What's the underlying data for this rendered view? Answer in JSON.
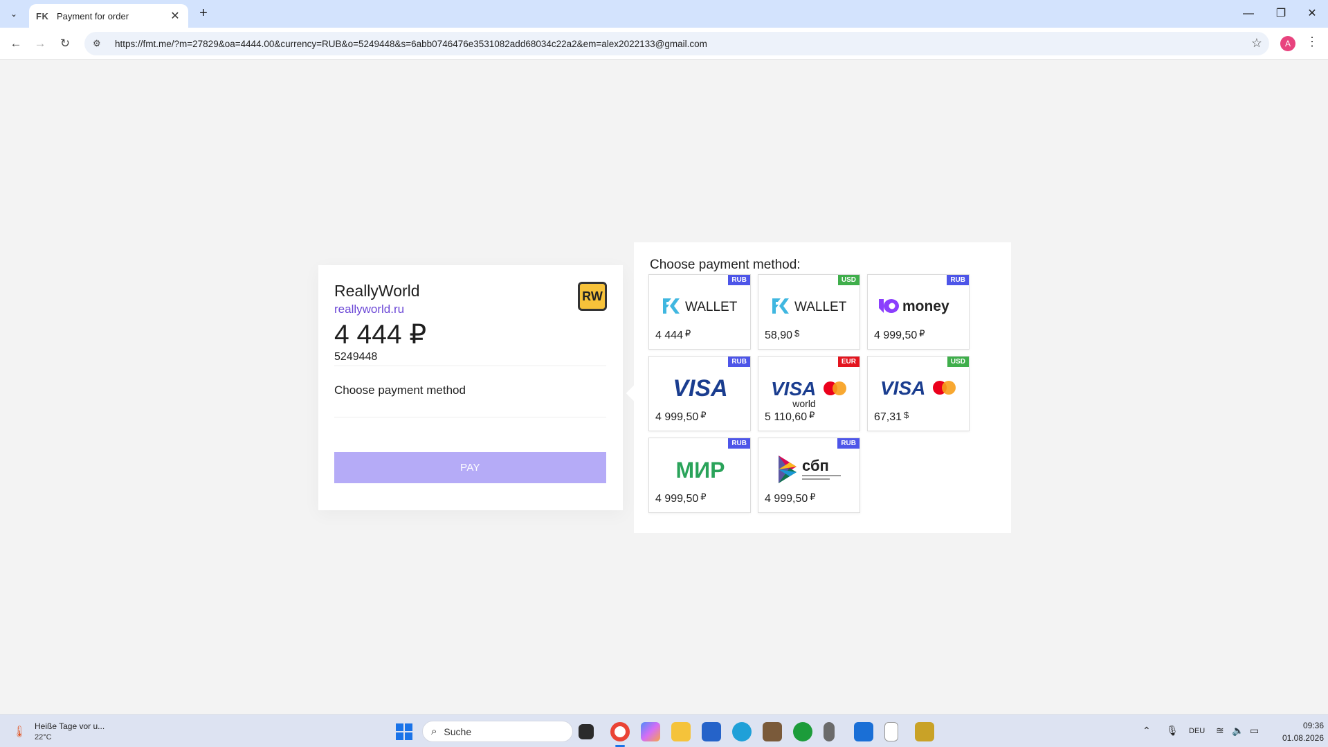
{
  "browser": {
    "tab_icon": "FK",
    "tab_title": "Payment for order",
    "url": "https://fmt.me/?m=27829&oa=4444.00&currency=RUB&o=5249448&s=6abb0746476e3531082add68034c22a2&em=alex2022133@gmail.com",
    "profile_initial": "A"
  },
  "order": {
    "merchant_name": "ReallyWorld",
    "merchant_site": "reallyworld.ru",
    "logo_text": "RW",
    "amount": "4 444 ₽",
    "order_id": "5249448",
    "method_placeholder": "Choose payment method",
    "pay_label": "PAY"
  },
  "methods": {
    "title": "Choose payment method:",
    "items": [
      {
        "name": "fk-wallet",
        "badge": "RUB",
        "price": "4 444",
        "currency": "₽"
      },
      {
        "name": "fk-wallet",
        "badge": "USD",
        "price": "58,90",
        "currency": "$"
      },
      {
        "name": "yoomoney",
        "badge": "RUB",
        "logo_text": "money",
        "price": "4 999,50",
        "currency": "₽"
      },
      {
        "name": "visa",
        "badge": "RUB",
        "logo_text": "VISA",
        "price": "4 999,50",
        "currency": "₽"
      },
      {
        "name": "visa-mastercard-world",
        "badge": "EUR",
        "logo_text": "VISA",
        "sub": "world",
        "price": "5 110,60",
        "currency": "₽"
      },
      {
        "name": "visa-mastercard",
        "badge": "USD",
        "logo_text": "VISA",
        "price": "67,31",
        "currency": "$"
      },
      {
        "name": "mir",
        "badge": "RUB",
        "logo_text": "МИР",
        "price": "4 999,50",
        "currency": "₽"
      },
      {
        "name": "sbp",
        "badge": "RUB",
        "logo_text": "сбп",
        "price": "4 999,50",
        "currency": "₽"
      }
    ],
    "wallet_text": "WALLET"
  },
  "colors": {
    "badge_rub": "#4d55e8",
    "badge_usd": "#3fae4b",
    "badge_eur": "#e3141e",
    "pay_button": "#b5abf7",
    "link": "#6b47d6"
  },
  "taskbar": {
    "weather_title": "Heiße Tage vor u...",
    "weather_temp": "22°C",
    "search_placeholder": "Suche",
    "language": "DEU",
    "time": "09:36",
    "date": "01.08.2026"
  }
}
